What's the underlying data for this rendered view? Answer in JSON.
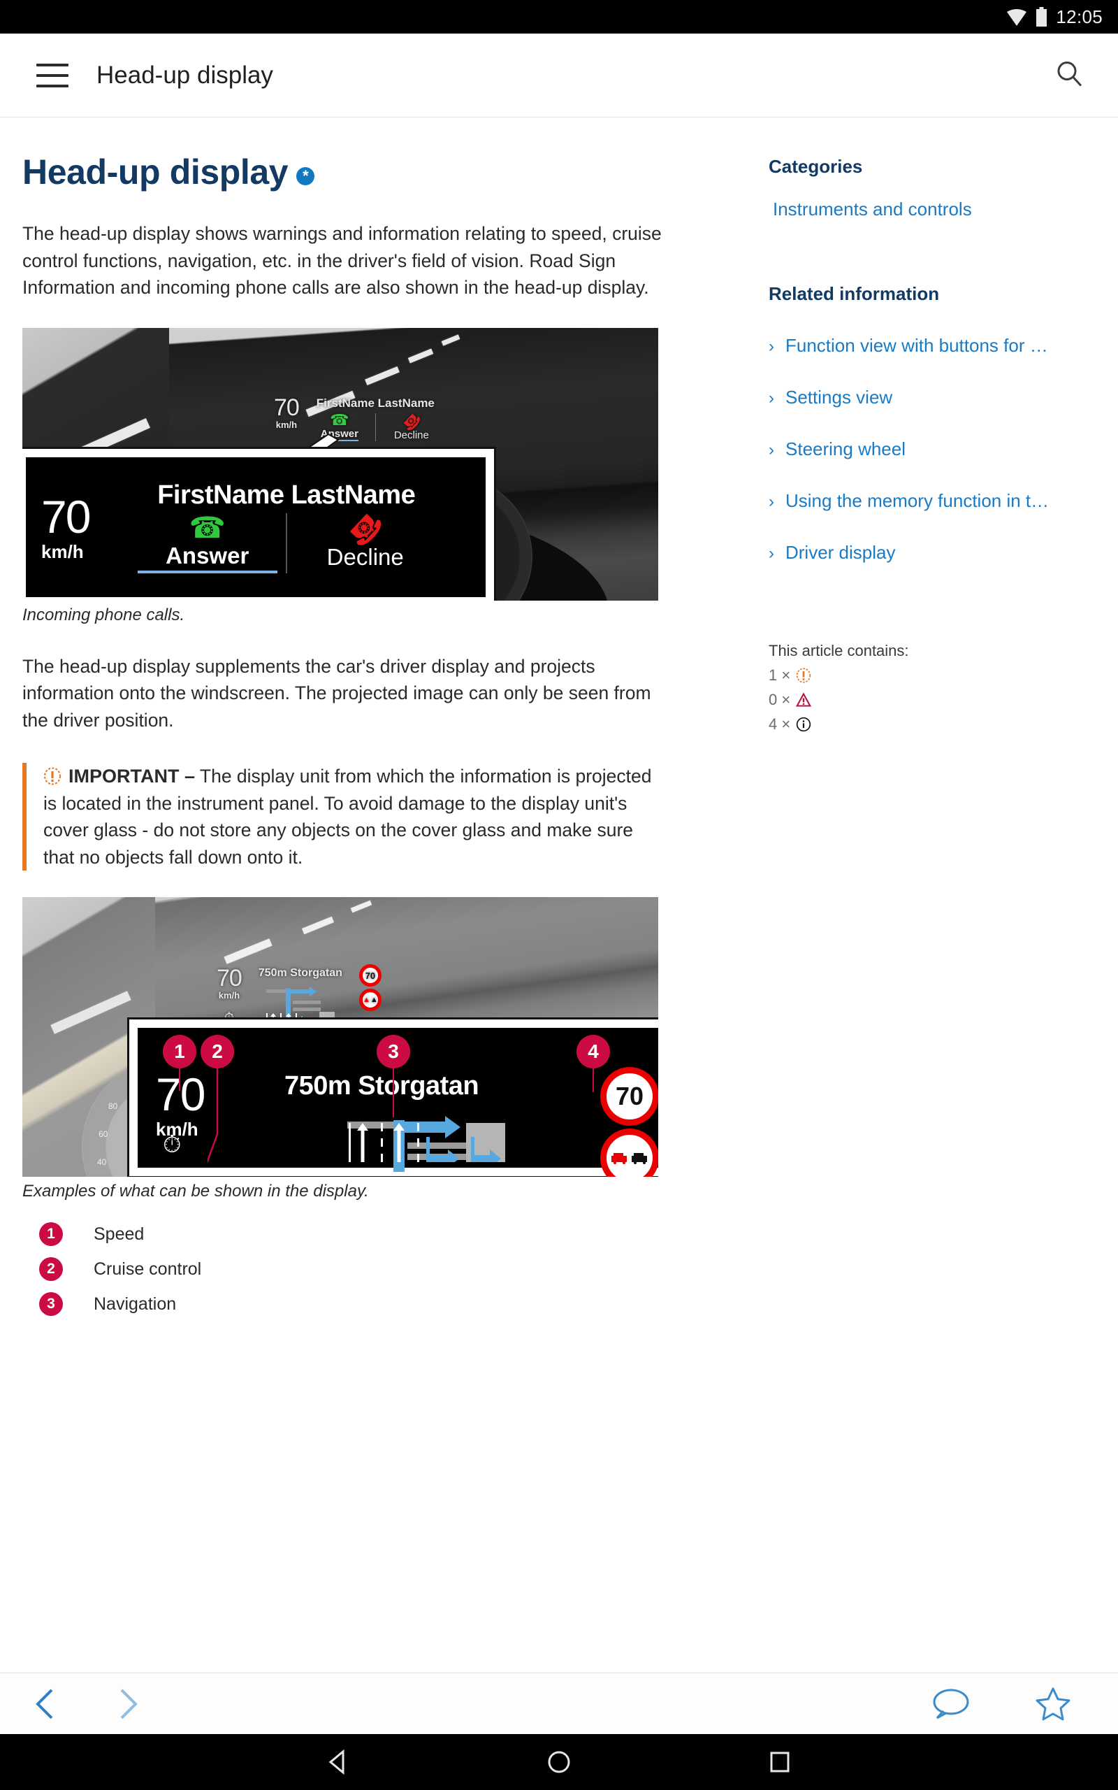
{
  "status_bar": {
    "time": "12:05",
    "wifi_icon": "wifi-icon",
    "battery_icon": "battery-icon"
  },
  "app_bar": {
    "menu_icon": "hamburger-menu-icon",
    "title": "Head-up display",
    "search_icon": "search-icon"
  },
  "article": {
    "title": "Head-up display",
    "title_badge": "*",
    "intro": "The head-up display shows warnings and information relating to speed, cruise control functions, navigation, etc. in the driver's field of vision. Road Sign Information and incoming phone calls are also shown in the head-up display.",
    "figure1": {
      "caption": "Incoming phone calls.",
      "hud": {
        "speed": "70",
        "unit": "km/h",
        "caller_name": "FirstName LastName",
        "answer_label": "Answer",
        "decline_label": "Decline"
      }
    },
    "para2": "The head-up display supplements the car's driver display and projects information onto the windscreen. The projected image can only be seen from the driver position.",
    "important": {
      "icon": "important-icon",
      "label": "IMPORTANT –",
      "text": "The display unit from which the information is projected is located in the instrument panel. To avoid damage to the display unit's cover glass - do not store any objects on the cover glass and make sure that no objects fall down onto it."
    },
    "figure2": {
      "caption": "Examples of what can be shown in the display.",
      "hud": {
        "speed": "70",
        "unit": "km/h",
        "navigation": "750m Storgatan",
        "speed_sign": "70",
        "cluster_speed": "70",
        "cluster_unit": "km/h"
      },
      "callouts": [
        "1",
        "2",
        "3",
        "4"
      ]
    },
    "numbered_list": [
      {
        "num": "1",
        "label": "Speed"
      },
      {
        "num": "2",
        "label": "Cruise control"
      }
    ]
  },
  "sidebar": {
    "categories_heading": "Categories",
    "categories": [
      "Instruments and controls"
    ],
    "related_heading": "Related information",
    "related": [
      "Function view with buttons for …",
      "Settings view",
      "Steering wheel",
      "Using the memory function in t…",
      "Driver display"
    ],
    "contains_heading": "This article contains:",
    "contains": [
      {
        "count": "1 ×",
        "icon": "important-icon"
      },
      {
        "count": "0 ×",
        "icon": "warning-triangle-icon"
      },
      {
        "count": "4 ×",
        "icon": "note-info-icon"
      }
    ]
  },
  "bottom_bar": {
    "prev_icon": "chevron-left-icon",
    "next_icon": "chevron-right-icon",
    "comment_icon": "speech-bubble-icon",
    "favorite_icon": "star-icon"
  },
  "nav_bar": {
    "back_icon": "android-back-icon",
    "home_icon": "android-home-icon",
    "recents_icon": "android-recents-icon"
  },
  "colors": {
    "title_navy": "#123a63",
    "link_blue": "#1a7ac4",
    "badge_blue": "#1179bf",
    "callout_red": "#cc0b42",
    "important_orange": "#e87722",
    "warning_red": "#b5123c"
  }
}
